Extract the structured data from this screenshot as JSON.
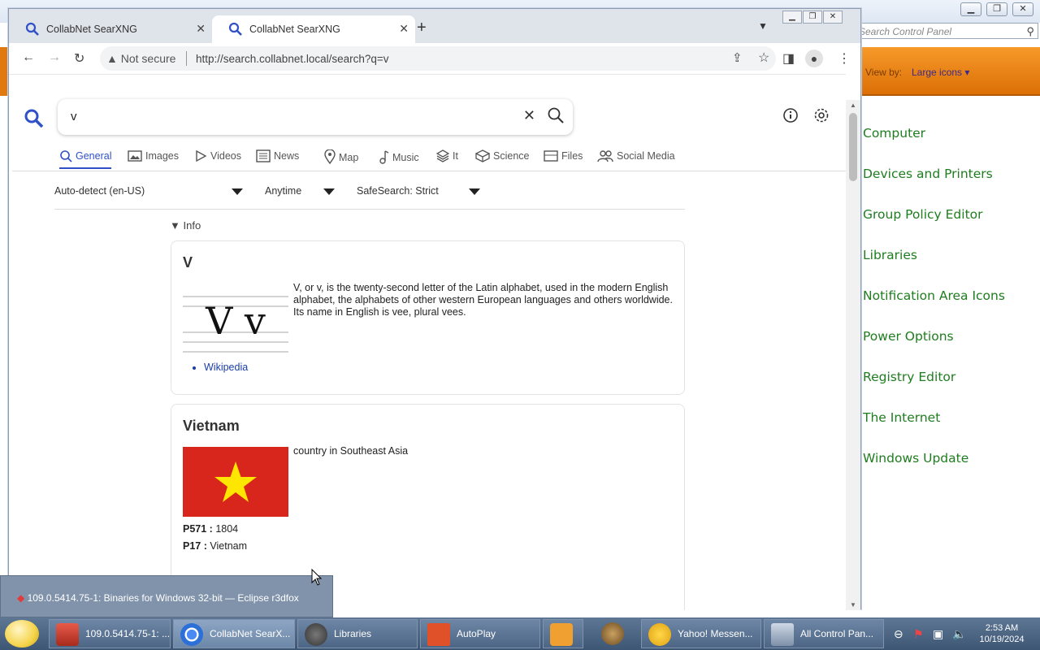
{
  "control_panel": {
    "search_placeholder": "Search Control Panel",
    "view_by_label": "View by:",
    "view_by_value": "Large icons ▾",
    "items": [
      "Computer",
      "Devices and Printers",
      "Group Policy Editor",
      "Libraries",
      "Notification Area Icons",
      "Power Options",
      "Registry Editor",
      "The Internet",
      "Windows Update"
    ]
  },
  "browser": {
    "tabs": [
      {
        "title": "CollabNet SearXNG"
      },
      {
        "title": "CollabNet SearXNG"
      }
    ],
    "security_label": "Not secure",
    "url": "http://search.collabnet.local/search?q=v"
  },
  "search": {
    "query": "v",
    "categories": [
      "General",
      "Images",
      "Videos",
      "News",
      "Map",
      "Music",
      "It",
      "Science",
      "Files",
      "Social Media"
    ],
    "filters": {
      "language": "Auto-detect (en-US)",
      "time": "Anytime",
      "safesearch": "SafeSearch: Strict"
    },
    "info_label": "Info",
    "cards": [
      {
        "title": "V",
        "description": "V, or v, is the twenty-second letter of the Latin alphabet, used in the modern English alphabet, the alphabets of other western European languages and others worldwide. Its name in English is vee, plural vees.",
        "image_text": "V v",
        "links": [
          "Wikipedia"
        ]
      },
      {
        "title": "Vietnam",
        "description": "country in Southeast Asia",
        "props": [
          {
            "key": "P571 :",
            "value": "1804"
          },
          {
            "key": "P17 :",
            "value": "Vietnam"
          }
        ]
      }
    ]
  },
  "tooltip": "109.0.5414.75-1: Binaries for Windows 32-bit — Eclipse r3dfox",
  "taskbar": {
    "tasks": [
      "109.0.5414.75-1: ...",
      "CollabNet SearX...",
      "Libraries",
      "AutoPlay",
      "",
      "",
      "Yahoo! Messen...",
      "All Control Pan..."
    ],
    "time": "2:53 AM",
    "date": "10/19/2024"
  },
  "colors": {
    "accent": "#3050c8",
    "cp_link": "#1e7d1e",
    "flag_red": "#d9261c",
    "flag_star": "#ffe600",
    "cp_orange": "#f0860f"
  }
}
